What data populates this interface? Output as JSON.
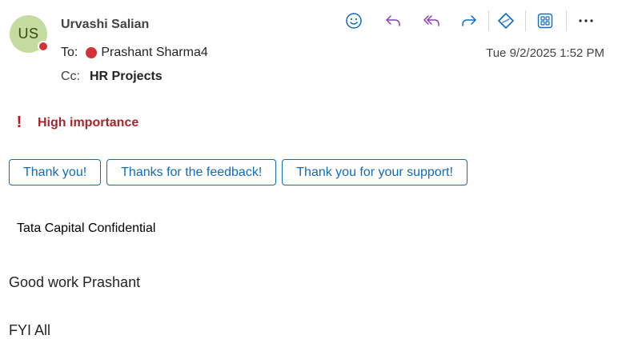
{
  "message": {
    "sender": {
      "name": "Urvashi Salian",
      "initials": "US",
      "avatar_color": "#c5dca0",
      "presence_color": "#d13438"
    },
    "to": {
      "label": "To:",
      "name": "Prashant Sharma4",
      "presence_color": "#d13438"
    },
    "cc": {
      "label": "Cc:",
      "name": "HR Projects"
    },
    "timestamp": "Tue 9/2/2025 1:52 PM",
    "importance": {
      "icon": "exclamation-icon",
      "label": "High importance",
      "color": "#a4262c"
    },
    "classification": "Tata Capital Confidential",
    "body": [
      "Good work Prashant",
      "FYI All"
    ]
  },
  "toolbar": {
    "icons": [
      "emoji-react-icon",
      "reply-icon",
      "reply-all-icon",
      "forward-icon",
      "copilot-icon",
      "apps-icon",
      "more-icon"
    ]
  },
  "suggested_replies": [
    "Thank you!",
    "Thanks for the feedback!",
    "Thank you for your support!"
  ],
  "colors": {
    "accent": "#0f6cbd",
    "reply_purple": "#8b3fb0"
  }
}
